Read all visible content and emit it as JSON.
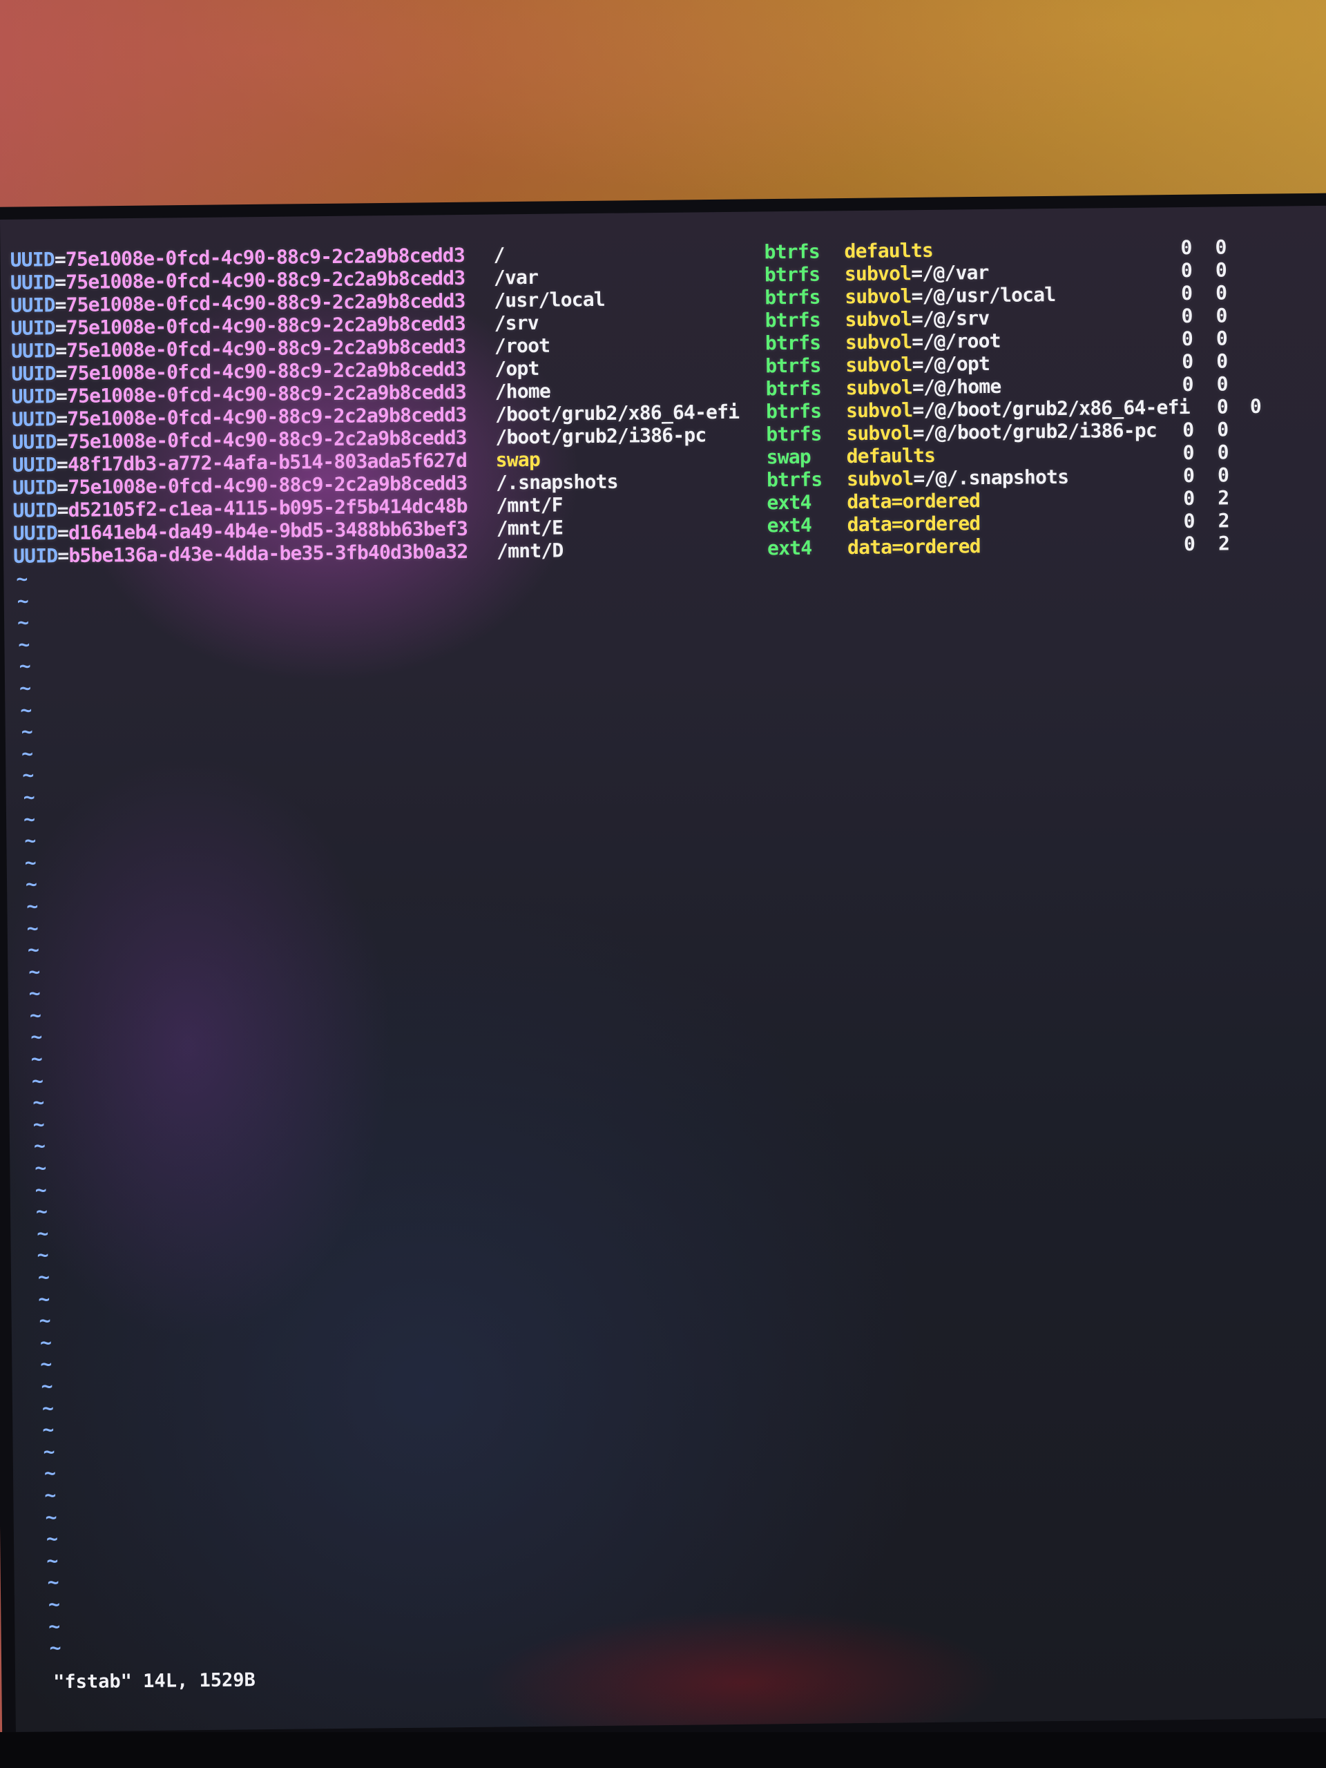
{
  "editor": {
    "file_message": "\"fstab\" 14L, 1529B",
    "empty_line_marker": "~",
    "empty_line_count": 50
  },
  "fstab": {
    "rows": [
      {
        "key": "UUID",
        "uuid": "75e1008e-0fcd-4c90-88c9-2c2a9b8cedd3",
        "mount": "/",
        "type": "btrfs",
        "opt_key": "defaults",
        "opt_val": "",
        "dump": "0",
        "pass": "0"
      },
      {
        "key": "UUID",
        "uuid": "75e1008e-0fcd-4c90-88c9-2c2a9b8cedd3",
        "mount": "/var",
        "type": "btrfs",
        "opt_key": "subvol",
        "opt_val": "=/@/var",
        "dump": "0",
        "pass": "0"
      },
      {
        "key": "UUID",
        "uuid": "75e1008e-0fcd-4c90-88c9-2c2a9b8cedd3",
        "mount": "/usr/local",
        "type": "btrfs",
        "opt_key": "subvol",
        "opt_val": "=/@/usr/local",
        "dump": "0",
        "pass": "0"
      },
      {
        "key": "UUID",
        "uuid": "75e1008e-0fcd-4c90-88c9-2c2a9b8cedd3",
        "mount": "/srv",
        "type": "btrfs",
        "opt_key": "subvol",
        "opt_val": "=/@/srv",
        "dump": "0",
        "pass": "0"
      },
      {
        "key": "UUID",
        "uuid": "75e1008e-0fcd-4c90-88c9-2c2a9b8cedd3",
        "mount": "/root",
        "type": "btrfs",
        "opt_key": "subvol",
        "opt_val": "=/@/root",
        "dump": "0",
        "pass": "0"
      },
      {
        "key": "UUID",
        "uuid": "75e1008e-0fcd-4c90-88c9-2c2a9b8cedd3",
        "mount": "/opt",
        "type": "btrfs",
        "opt_key": "subvol",
        "opt_val": "=/@/opt",
        "dump": "0",
        "pass": "0"
      },
      {
        "key": "UUID",
        "uuid": "75e1008e-0fcd-4c90-88c9-2c2a9b8cedd3",
        "mount": "/home",
        "type": "btrfs",
        "opt_key": "subvol",
        "opt_val": "=/@/home",
        "dump": "0",
        "pass": "0"
      },
      {
        "key": "UUID",
        "uuid": "75e1008e-0fcd-4c90-88c9-2c2a9b8cedd3",
        "mount": "/boot/grub2/x86_64-efi",
        "type": "btrfs",
        "opt_key": "subvol",
        "opt_val": "=/@/boot/grub2/x86_64-efi",
        "dump": "0",
        "pass": "0",
        "wide": true
      },
      {
        "key": "UUID",
        "uuid": "75e1008e-0fcd-4c90-88c9-2c2a9b8cedd3",
        "mount": "/boot/grub2/i386-pc",
        "type": "btrfs",
        "opt_key": "subvol",
        "opt_val": "=/@/boot/grub2/i386-pc",
        "dump": "0",
        "pass": "0"
      },
      {
        "key": "UUID",
        "uuid": "48f17db3-a772-4afa-b514-803ada5f627d",
        "mount": "swap",
        "type": "swap",
        "opt_key": "defaults",
        "opt_val": "",
        "dump": "0",
        "pass": "0",
        "swap": true
      },
      {
        "key": "UUID",
        "uuid": "75e1008e-0fcd-4c90-88c9-2c2a9b8cedd3",
        "mount": "/.snapshots",
        "type": "btrfs",
        "opt_key": "subvol",
        "opt_val": "=/@/.snapshots",
        "dump": "0",
        "pass": "0"
      },
      {
        "key": "UUID",
        "uuid": "d52105f2-c1ea-4115-b095-2f5b414dc48b",
        "mount": "/mnt/F",
        "type": "ext4",
        "opt_key": "data",
        "opt_val": "=ordered",
        "dump": "0",
        "pass": "2",
        "ordered": true
      },
      {
        "key": "UUID",
        "uuid": "d1641eb4-da49-4b4e-9bd5-3488bb63bef3",
        "mount": "/mnt/E",
        "type": "ext4",
        "opt_key": "data",
        "opt_val": "=ordered",
        "dump": "0",
        "pass": "2",
        "ordered": true
      },
      {
        "key": "UUID",
        "uuid": "b5be136a-d43e-4dda-be35-3fb40d3b0a32",
        "mount": "/mnt/D",
        "type": "ext4",
        "opt_key": "data",
        "opt_val": "=ordered",
        "dump": "0",
        "pass": "2",
        "ordered": true
      }
    ]
  }
}
